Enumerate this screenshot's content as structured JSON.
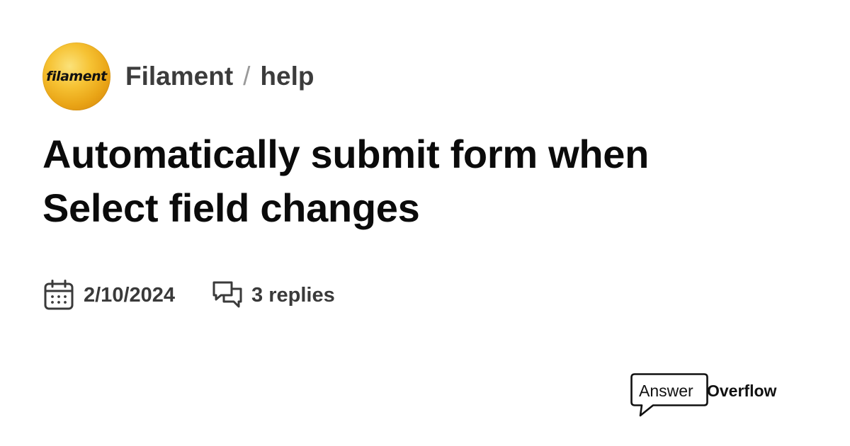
{
  "server": {
    "logo_text": "filament",
    "name": "Filament",
    "separator": "/",
    "channel": "help",
    "logo_colors": [
      "#fbe27a",
      "#f6c233",
      "#e9a416",
      "#cf7e0b"
    ]
  },
  "thread": {
    "title_line1": "Automatically submit form when",
    "title_line2": "Select field changes",
    "date": "2/10/2024",
    "replies": "3 replies"
  },
  "icons": {
    "date": "calendar-icon",
    "replies": "chat-bubbles-icon",
    "brand": "speech-bubble-icon"
  },
  "brand": {
    "part1": "Answer",
    "part2": "Overflow"
  }
}
